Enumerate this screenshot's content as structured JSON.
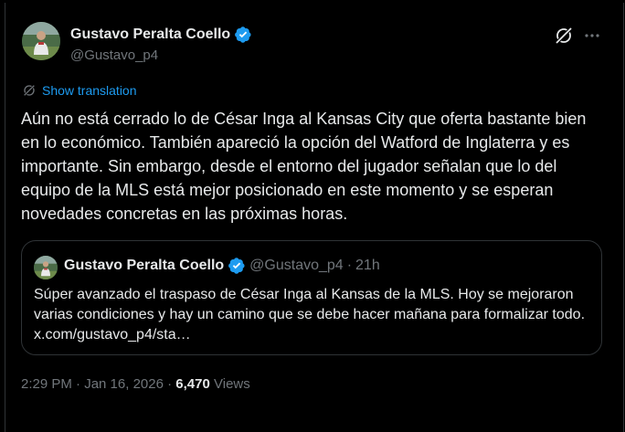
{
  "tweet": {
    "author": {
      "display_name": "Gustavo Peralta Coello",
      "handle": "@Gustavo_p4"
    },
    "translation_label": "Show translation",
    "text": "Aún no está cerrado lo de César Inga al Kansas City que oferta bastante bien en lo económico. También apareció la opción del Watford de Inglaterra y es importante. Sin embargo, desde el entorno del jugador señalan que lo del equipo de la MLS está mejor posicionado en este momento y se esperan novedades concretas en las próximas horas.",
    "timestamp": "2:29 PM · Jan 16, 2026",
    "separator": "·",
    "views_count": "6,470",
    "views_label": "Views"
  },
  "quote": {
    "author": {
      "display_name": "Gustavo Peralta Coello",
      "handle": "@Gustavo_p4"
    },
    "separator": "·",
    "relative_time": "21h",
    "text": "Súper avanzado el traspaso de César Inga al Kansas de la MLS. Hoy se mejoraron varias condiciones y hay un camino que se debe hacer mañana para formalizar todo. x.com/gustavo_p4/sta…"
  },
  "icons": {
    "verified": "verified-badge-icon",
    "grok": "grok-icon",
    "more": "more-options-icon",
    "translate": "translate-icon"
  },
  "colors": {
    "background": "#000000",
    "text": "#e7e9ea",
    "secondary": "#71767b",
    "accent": "#1d9bf0",
    "border": "#2f3336"
  }
}
